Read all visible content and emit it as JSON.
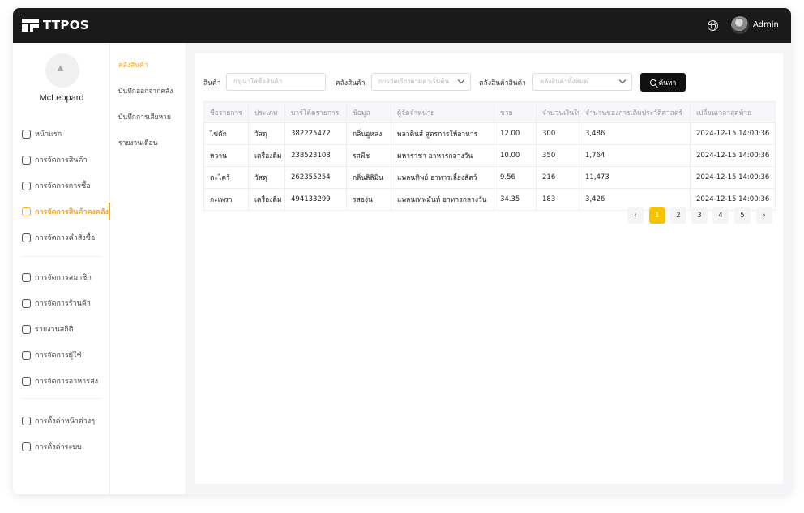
{
  "app": {
    "brand": "TTPOS",
    "user": "Admin"
  },
  "sidebar": {
    "username": "McLeopard",
    "items": [
      {
        "label": "หน้าแรก",
        "icon": "dashboard-icon"
      },
      {
        "label": "การจัดการสินค้า",
        "icon": "box-icon"
      },
      {
        "label": "การจัดการการซื้อ",
        "icon": "cart-icon"
      },
      {
        "label": "การจัดการสินค้าคงคลัง",
        "icon": "inventory-icon"
      },
      {
        "label": "การจัดการคำสั่งซื้อ",
        "icon": "order-icon"
      },
      {
        "label": "การจัดการสมาชิก",
        "icon": "member-icon"
      },
      {
        "label": "การจัดการร้านค้า",
        "icon": "store-icon"
      },
      {
        "label": "รายงานสถิติ",
        "icon": "report-icon"
      },
      {
        "label": "การจัดการผู้ใช้",
        "icon": "users-icon"
      },
      {
        "label": "การจัดการอาหารส่ง",
        "icon": "delivery-icon"
      },
      {
        "label": "การตั้งค่าหน้าต่างๆ",
        "icon": "page-settings-icon"
      },
      {
        "label": "การตั้งค่าระบบ",
        "icon": "gear-icon"
      }
    ]
  },
  "subnav": {
    "items": [
      "คลังสินค้า",
      "บันทึกออกจากคลัง",
      "บันทึกการเสียหาย",
      "รายงานเดือน"
    ]
  },
  "filters": {
    "product_label": "สินค้า",
    "product_placeholder": "กรุณาใส่ชื่อสินค้า",
    "warehouse_label": "คลังสินค้า",
    "warehouse_value": "การจัดเรียงตามค่าเริ่มต้น",
    "stock_label": "คลังสินค้าสินค้า",
    "stock_value": "คลังสินค้าทั้งหมด",
    "search_label": "ค้นหา"
  },
  "table": {
    "columns": [
      "ชื่อรายการ",
      "ประเภท",
      "บาร์โค้ดรายการ",
      "ข้อมูล",
      "ผู้จัดจำหน่าย",
      "ขาย",
      "จำนวนเงินใน",
      "จำนวนของการเติมประวัติศาสตร์",
      "เปลี่ยนเวลาสุดท้าย"
    ],
    "rows": [
      [
        "ไข่ดัก",
        "วัสดุ",
        "382225472",
        "กลิ่นอูหลง",
        "พลาดินส์ สูตรการให้อาหาร",
        "12.00",
        "300",
        "3,486",
        "2024-12-15 14:00:36"
      ],
      [
        "หวาน",
        "เครื่องดื่ม",
        "238523108",
        "รสพีช",
        "มหาราชา อาหารกลางวัน",
        "10.00",
        "350",
        "1,764",
        "2024-12-15 14:00:36"
      ],
      [
        "ตะไคร้",
        "วัสดุ",
        "262355254",
        "กลิ่นลิลิมิน",
        "แพลนทิพย์ อาหารเลี้ยงสัตว์",
        "9.56",
        "216",
        "11,473",
        "2024-12-15 14:00:36"
      ],
      [
        "กะเพรา",
        "เครื่องดื่ม",
        "494133299",
        "รสองุ่น",
        "แพลนเทพมันท์ อาหารกลางวัน",
        "34.35",
        "183",
        "3,426",
        "2024-12-15 14:00:36"
      ]
    ]
  },
  "pagination": {
    "prev": "‹",
    "pages": [
      "1",
      "2",
      "3",
      "4",
      "5"
    ],
    "next": "›",
    "current": "1"
  },
  "colors": {
    "accent": "#f5a623",
    "topbar": "#1a1a1a",
    "page_active": "#f5c400"
  }
}
